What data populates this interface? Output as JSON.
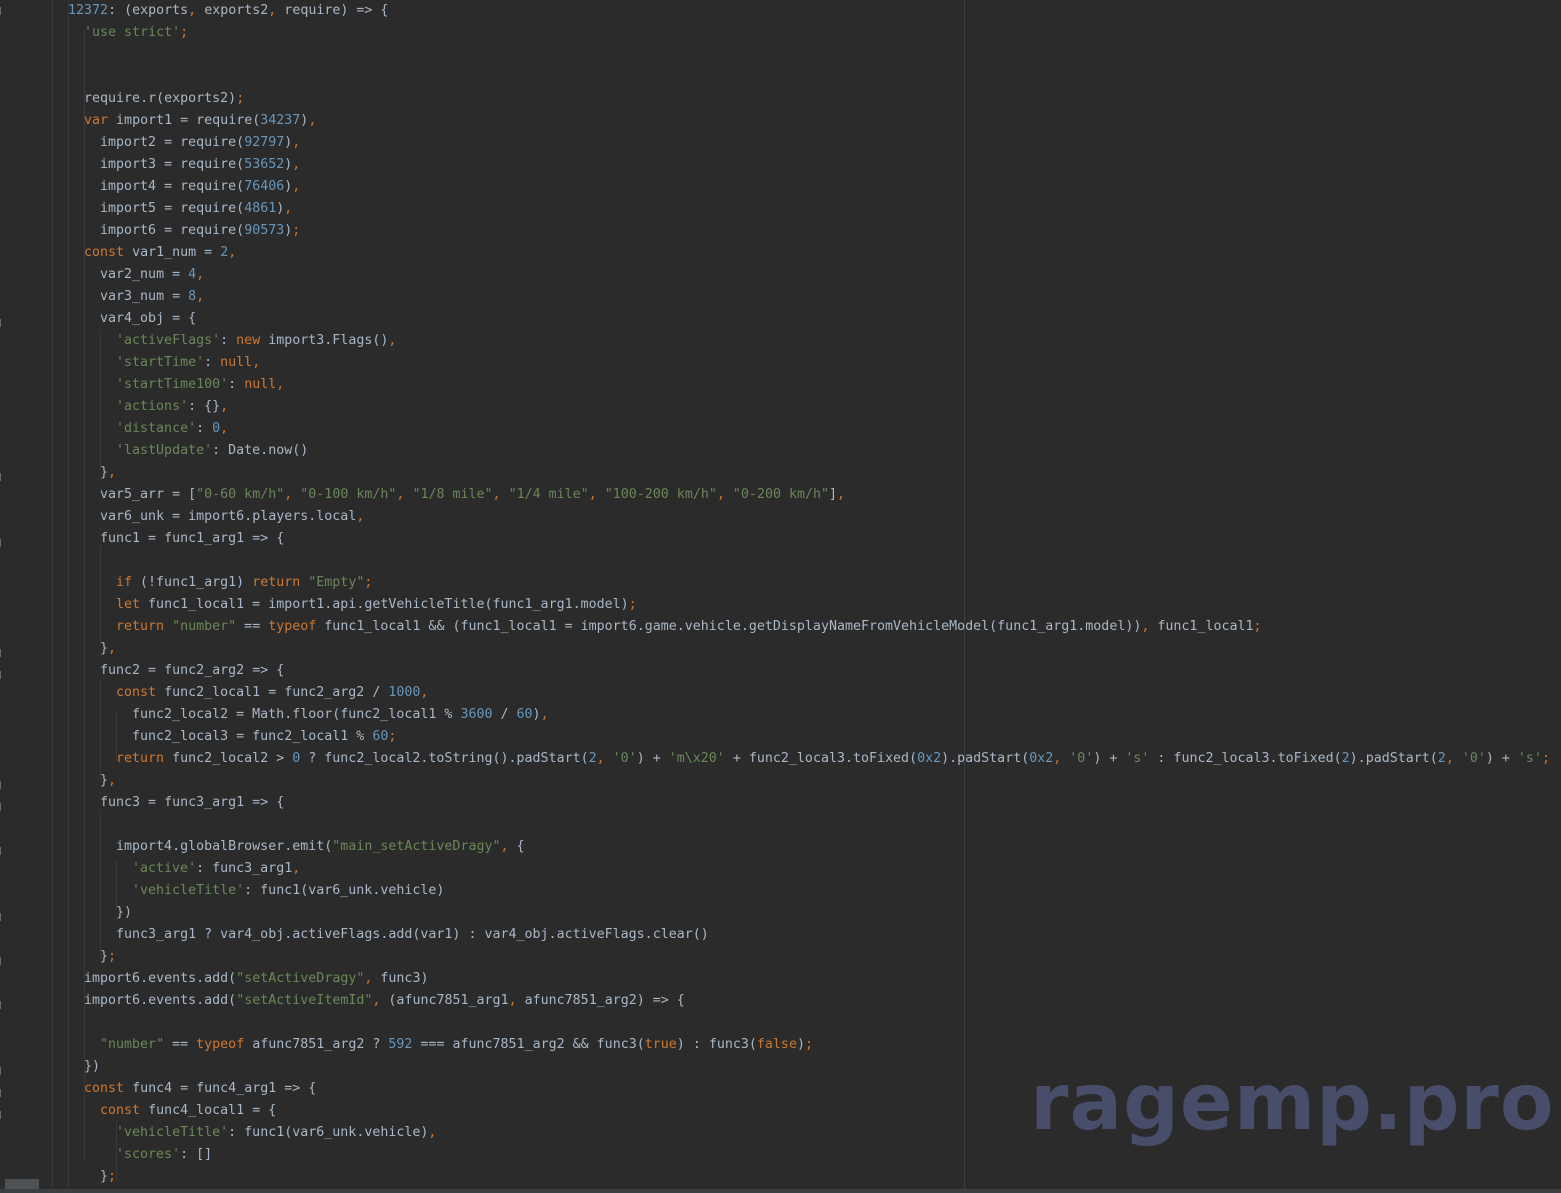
{
  "editor": {
    "lines": [
      [
        {
          "t": "12372",
          "c": "num"
        },
        {
          "t": ": (exports",
          "c": "id"
        },
        {
          "t": ",",
          "c": "pn"
        },
        {
          "t": " exports2",
          "c": "id"
        },
        {
          "t": ",",
          "c": "pn"
        },
        {
          "t": " require) => {",
          "c": "id"
        }
      ],
      [
        {
          "t": "'use strict'",
          "c": "str"
        },
        {
          "t": ";",
          "c": "pn"
        }
      ],
      [],
      [],
      [
        {
          "t": "require.r(exports2)",
          "c": "id"
        },
        {
          "t": ";",
          "c": "pn"
        }
      ],
      [
        {
          "t": "var ",
          "c": "kw"
        },
        {
          "t": "import1 = require(",
          "c": "id"
        },
        {
          "t": "34237",
          "c": "num"
        },
        {
          "t": ")",
          "c": "id"
        },
        {
          "t": ",",
          "c": "pn"
        }
      ],
      [
        {
          "t": "import2 = require(",
          "c": "id"
        },
        {
          "t": "92797",
          "c": "num"
        },
        {
          "t": ")",
          "c": "id"
        },
        {
          "t": ",",
          "c": "pn"
        }
      ],
      [
        {
          "t": "import3 = require(",
          "c": "id"
        },
        {
          "t": "53652",
          "c": "num"
        },
        {
          "t": ")",
          "c": "id"
        },
        {
          "t": ",",
          "c": "pn"
        }
      ],
      [
        {
          "t": "import4 = require(",
          "c": "id"
        },
        {
          "t": "76406",
          "c": "num"
        },
        {
          "t": ")",
          "c": "id"
        },
        {
          "t": ",",
          "c": "pn"
        }
      ],
      [
        {
          "t": "import5 = require(",
          "c": "id"
        },
        {
          "t": "4861",
          "c": "num"
        },
        {
          "t": ")",
          "c": "id"
        },
        {
          "t": ",",
          "c": "pn"
        }
      ],
      [
        {
          "t": "import6 = require(",
          "c": "id"
        },
        {
          "t": "90573",
          "c": "num"
        },
        {
          "t": ")",
          "c": "id"
        },
        {
          "t": ";",
          "c": "pn"
        }
      ],
      [
        {
          "t": "const ",
          "c": "kw"
        },
        {
          "t": "var1_num = ",
          "c": "id"
        },
        {
          "t": "2",
          "c": "num"
        },
        {
          "t": ",",
          "c": "pn"
        }
      ],
      [
        {
          "t": "var2_num = ",
          "c": "id"
        },
        {
          "t": "4",
          "c": "num"
        },
        {
          "t": ",",
          "c": "pn"
        }
      ],
      [
        {
          "t": "var3_num = ",
          "c": "id"
        },
        {
          "t": "8",
          "c": "num"
        },
        {
          "t": ",",
          "c": "pn"
        }
      ],
      [
        {
          "t": "var4_obj = {",
          "c": "id"
        }
      ],
      [
        {
          "t": "'activeFlags'",
          "c": "str"
        },
        {
          "t": ": ",
          "c": "id"
        },
        {
          "t": "new ",
          "c": "kw"
        },
        {
          "t": "import3.Flags()",
          "c": "id"
        },
        {
          "t": ",",
          "c": "pn"
        }
      ],
      [
        {
          "t": "'startTime'",
          "c": "str"
        },
        {
          "t": ": ",
          "c": "id"
        },
        {
          "t": "null",
          "c": "lit"
        },
        {
          "t": ",",
          "c": "pn"
        }
      ],
      [
        {
          "t": "'startTime100'",
          "c": "str"
        },
        {
          "t": ": ",
          "c": "id"
        },
        {
          "t": "null",
          "c": "lit"
        },
        {
          "t": ",",
          "c": "pn"
        }
      ],
      [
        {
          "t": "'actions'",
          "c": "str"
        },
        {
          "t": ": {}",
          "c": "id"
        },
        {
          "t": ",",
          "c": "pn"
        }
      ],
      [
        {
          "t": "'distance'",
          "c": "str"
        },
        {
          "t": ": ",
          "c": "id"
        },
        {
          "t": "0",
          "c": "num"
        },
        {
          "t": ",",
          "c": "pn"
        }
      ],
      [
        {
          "t": "'lastUpdate'",
          "c": "str"
        },
        {
          "t": ": Date.now()",
          "c": "id"
        }
      ],
      [
        {
          "t": "}",
          "c": "id"
        },
        {
          "t": ",",
          "c": "pn"
        }
      ],
      [
        {
          "t": "var5_arr = [",
          "c": "id"
        },
        {
          "t": "\"0-60 km/h\"",
          "c": "str"
        },
        {
          "t": ", ",
          "c": "pn"
        },
        {
          "t": "\"0-100 km/h\"",
          "c": "str"
        },
        {
          "t": ", ",
          "c": "pn"
        },
        {
          "t": "\"1/8 mile\"",
          "c": "str"
        },
        {
          "t": ", ",
          "c": "pn"
        },
        {
          "t": "\"1/4 mile\"",
          "c": "str"
        },
        {
          "t": ", ",
          "c": "pn"
        },
        {
          "t": "\"100-200 km/h\"",
          "c": "str"
        },
        {
          "t": ", ",
          "c": "pn"
        },
        {
          "t": "\"0-200 km/h\"",
          "c": "str"
        },
        {
          "t": "]",
          "c": "id"
        },
        {
          "t": ",",
          "c": "pn"
        }
      ],
      [
        {
          "t": "var6_unk = import6.players.local",
          "c": "id"
        },
        {
          "t": ",",
          "c": "pn"
        }
      ],
      [
        {
          "t": "func1 = func1_arg1 => {",
          "c": "id"
        }
      ],
      [],
      [
        {
          "t": "if ",
          "c": "kw"
        },
        {
          "t": "(!func1_arg1) ",
          "c": "id"
        },
        {
          "t": "return ",
          "c": "kw"
        },
        {
          "t": "\"Empty\"",
          "c": "str"
        },
        {
          "t": ";",
          "c": "pn"
        }
      ],
      [
        {
          "t": "let ",
          "c": "kw"
        },
        {
          "t": "func1_local1 = import1.api.getVehicleTitle(func1_arg1.model)",
          "c": "id"
        },
        {
          "t": ";",
          "c": "pn"
        }
      ],
      [
        {
          "t": "return ",
          "c": "kw"
        },
        {
          "t": "\"number\"",
          "c": "str"
        },
        {
          "t": " == ",
          "c": "id"
        },
        {
          "t": "typeof ",
          "c": "kw"
        },
        {
          "t": "func1_local1 && (func1_local1 = import6.game.vehicle.getDisplayNameFromVehicleModel(func1_arg1.model))",
          "c": "id"
        },
        {
          "t": ", ",
          "c": "pn"
        },
        {
          "t": "func1_local1",
          "c": "id"
        },
        {
          "t": ";",
          "c": "pn"
        }
      ],
      [
        {
          "t": "}",
          "c": "id"
        },
        {
          "t": ",",
          "c": "pn"
        }
      ],
      [
        {
          "t": "func2 = func2_arg2 => {",
          "c": "id"
        }
      ],
      [
        {
          "t": "const ",
          "c": "kw"
        },
        {
          "t": "func2_local1 = func2_arg2 / ",
          "c": "id"
        },
        {
          "t": "1000",
          "c": "num"
        },
        {
          "t": ",",
          "c": "pn"
        }
      ],
      [
        {
          "t": "func2_local2 = Math.floor(func2_local1 % ",
          "c": "id"
        },
        {
          "t": "3600",
          "c": "num"
        },
        {
          "t": " / ",
          "c": "id"
        },
        {
          "t": "60",
          "c": "num"
        },
        {
          "t": ")",
          "c": "id"
        },
        {
          "t": ",",
          "c": "pn"
        }
      ],
      [
        {
          "t": "func2_local3 = func2_local1 % ",
          "c": "id"
        },
        {
          "t": "60",
          "c": "num"
        },
        {
          "t": ";",
          "c": "pn"
        }
      ],
      [
        {
          "t": "return ",
          "c": "kw"
        },
        {
          "t": "func2_local2 > ",
          "c": "id"
        },
        {
          "t": "0",
          "c": "num"
        },
        {
          "t": " ? func2_local2.toString().padStart(",
          "c": "id"
        },
        {
          "t": "2",
          "c": "num"
        },
        {
          "t": ", ",
          "c": "pn"
        },
        {
          "t": "'0'",
          "c": "str"
        },
        {
          "t": ") + ",
          "c": "id"
        },
        {
          "t": "'m\\x20'",
          "c": "str"
        },
        {
          "t": " + func2_local3.toFixed(",
          "c": "id"
        },
        {
          "t": "0x2",
          "c": "num"
        },
        {
          "t": ").padStart(",
          "c": "id"
        },
        {
          "t": "0x2",
          "c": "num"
        },
        {
          "t": ", ",
          "c": "pn"
        },
        {
          "t": "'0'",
          "c": "str"
        },
        {
          "t": ") + ",
          "c": "id"
        },
        {
          "t": "'s'",
          "c": "str"
        },
        {
          "t": " : func2_local3.toFixed(",
          "c": "id"
        },
        {
          "t": "2",
          "c": "num"
        },
        {
          "t": ").padStart(",
          "c": "id"
        },
        {
          "t": "2",
          "c": "num"
        },
        {
          "t": ", ",
          "c": "pn"
        },
        {
          "t": "'0'",
          "c": "str"
        },
        {
          "t": ") + ",
          "c": "id"
        },
        {
          "t": "'s'",
          "c": "str"
        },
        {
          "t": ";",
          "c": "pn"
        }
      ],
      [
        {
          "t": "}",
          "c": "id"
        },
        {
          "t": ",",
          "c": "pn"
        }
      ],
      [
        {
          "t": "func3 = func3_arg1 => {",
          "c": "id"
        }
      ],
      [],
      [
        {
          "t": "import4.globalBrowser.emit(",
          "c": "id"
        },
        {
          "t": "\"main_setActiveDragy\"",
          "c": "str"
        },
        {
          "t": ", ",
          "c": "pn"
        },
        {
          "t": "{",
          "c": "id"
        }
      ],
      [
        {
          "t": "'active'",
          "c": "str"
        },
        {
          "t": ": func3_arg1",
          "c": "id"
        },
        {
          "t": ",",
          "c": "pn"
        }
      ],
      [
        {
          "t": "'vehicleTitle'",
          "c": "str"
        },
        {
          "t": ": func1(var6_unk.vehicle)",
          "c": "id"
        }
      ],
      [
        {
          "t": "})",
          "c": "id"
        }
      ],
      [
        {
          "t": "func3_arg1 ? var4_obj.activeFlags.add(var1) : var4_obj.activeFlags.clear()",
          "c": "id"
        }
      ],
      [
        {
          "t": "}",
          "c": "id"
        },
        {
          "t": ";",
          "c": "pn"
        }
      ],
      [
        {
          "t": "import6.events.add(",
          "c": "id"
        },
        {
          "t": "\"setActiveDragy\"",
          "c": "str"
        },
        {
          "t": ", ",
          "c": "pn"
        },
        {
          "t": "func3)",
          "c": "id"
        }
      ],
      [
        {
          "t": "import6.events.add(",
          "c": "id"
        },
        {
          "t": "\"setActiveItemId\"",
          "c": "str"
        },
        {
          "t": ", ",
          "c": "pn"
        },
        {
          "t": "(afunc7851_arg1",
          "c": "id"
        },
        {
          "t": ", ",
          "c": "pn"
        },
        {
          "t": "afunc7851_arg2) => {",
          "c": "id"
        }
      ],
      [],
      [
        {
          "t": "\"number\"",
          "c": "str"
        },
        {
          "t": " == ",
          "c": "id"
        },
        {
          "t": "typeof ",
          "c": "kw"
        },
        {
          "t": "afunc7851_arg2 ? ",
          "c": "id"
        },
        {
          "t": "592",
          "c": "num"
        },
        {
          "t": " === afunc7851_arg2 && func3(",
          "c": "id"
        },
        {
          "t": "true",
          "c": "lit"
        },
        {
          "t": ") : func3(",
          "c": "id"
        },
        {
          "t": "false",
          "c": "lit"
        },
        {
          "t": ")",
          "c": "id"
        },
        {
          "t": ";",
          "c": "pn"
        }
      ],
      [
        {
          "t": "})",
          "c": "id"
        }
      ],
      [
        {
          "t": "const ",
          "c": "kw"
        },
        {
          "t": "func4 = func4_arg1 => {",
          "c": "id"
        }
      ],
      [
        {
          "t": "const ",
          "c": "kw"
        },
        {
          "t": "func4_local1 = {",
          "c": "id"
        }
      ],
      [
        {
          "t": "'vehicleTitle'",
          "c": "str"
        },
        {
          "t": ": func1(var6_unk.vehicle)",
          "c": "id"
        },
        {
          "t": ",",
          "c": "pn"
        }
      ],
      [
        {
          "t": "'scores'",
          "c": "str"
        },
        {
          "t": ": []",
          "c": "id"
        }
      ],
      [
        {
          "t": "}",
          "c": "id"
        },
        {
          "t": ";",
          "c": "pn"
        }
      ]
    ]
  },
  "watermark": {
    "text": "ragemp.pro"
  },
  "colors": {
    "background": "#2b2b2b",
    "keyword": "#cc7832",
    "string": "#6a8759",
    "number": "#6897bb",
    "identifier": "#a9b7c6",
    "watermark": "#4a4f6e"
  }
}
